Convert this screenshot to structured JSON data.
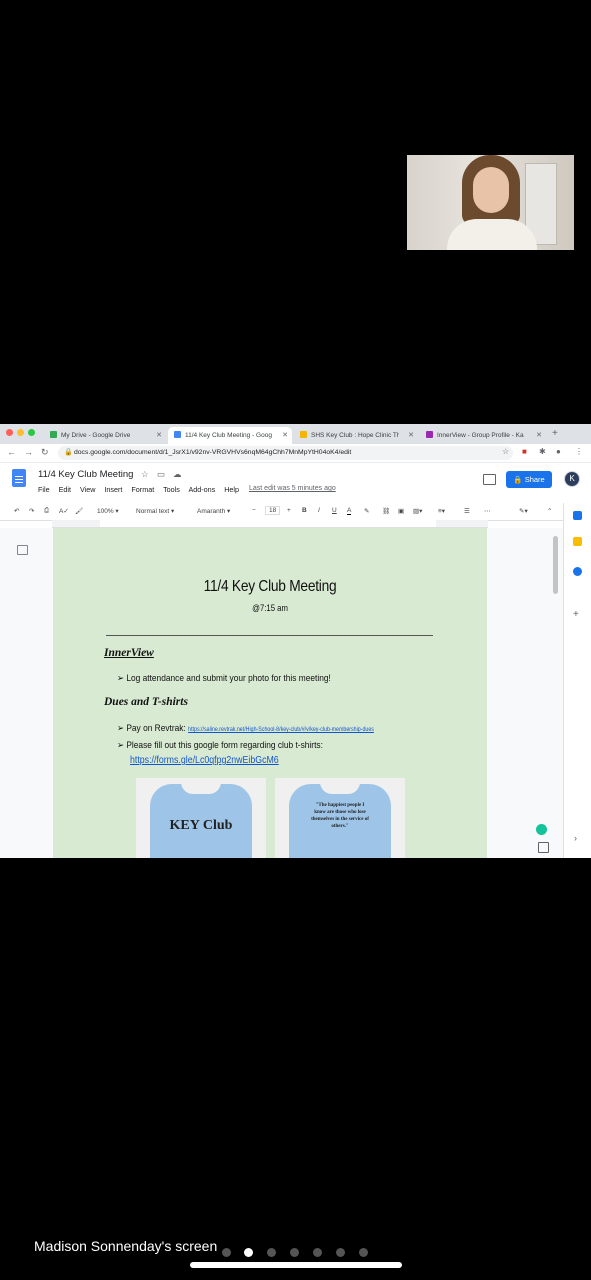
{
  "tabs": [
    {
      "label": "My Drive - Google Drive",
      "active": false,
      "favicon_color": "#34a853"
    },
    {
      "label": "11/4 Key Club Meeting - Goog",
      "active": true,
      "favicon_color": "#4285f4"
    },
    {
      "label": "SHS Key Club : Hope Clinic Th",
      "active": false,
      "favicon_color": "#f4b400"
    },
    {
      "label": "InnerView - Group Profile - Ka",
      "active": false,
      "favicon_color": "#9c27b0"
    }
  ],
  "address_bar": {
    "url": "docs.google.com/document/d/1_JsrX1/v92nv-VRGVHVs6nqM64gChh7MnMpYtH04oK4/edit"
  },
  "doc_header": {
    "title": "11/4 Key Club Meeting",
    "menu": [
      "File",
      "Edit",
      "View",
      "Insert",
      "Format",
      "Tools",
      "Add-ons",
      "Help"
    ],
    "last_edit": "Last edit was 5 minutes ago",
    "share_label": "Share",
    "avatar_letter": "K"
  },
  "toolbar": {
    "zoom": "100%",
    "style": "Normal text",
    "font": "Amaranth",
    "font_size": "18"
  },
  "document": {
    "title": "11/4 Key Club Meeting",
    "time": "@7:15 am",
    "section1_heading": "InnerView",
    "section1_bullet": "Log attendance and submit your photo for this meeting!",
    "section2_heading": "Dues and T-shirts",
    "bullet_pay_label": "Pay on Revtrak: ",
    "bullet_pay_link": "https://saline.revtrak.net/High-School-8/key-club/#/v/key-club-membership-dues",
    "bullet_form": "Please fill out this google form regarding club t-shirts:",
    "form_link": "https://forms.gle/Lc0qfpg2nwEibGcM6",
    "shirt_front_text": "KEY Club",
    "shirt_back_text": "\"The happiest people I know are those who lose themselves in the service of others.\""
  },
  "screen_share": {
    "caption": "Madison Sonnenday's screen"
  },
  "colors": {
    "page_bg": "#d9ead3",
    "link": "#1155cc",
    "share_button": "#1a73e8"
  }
}
